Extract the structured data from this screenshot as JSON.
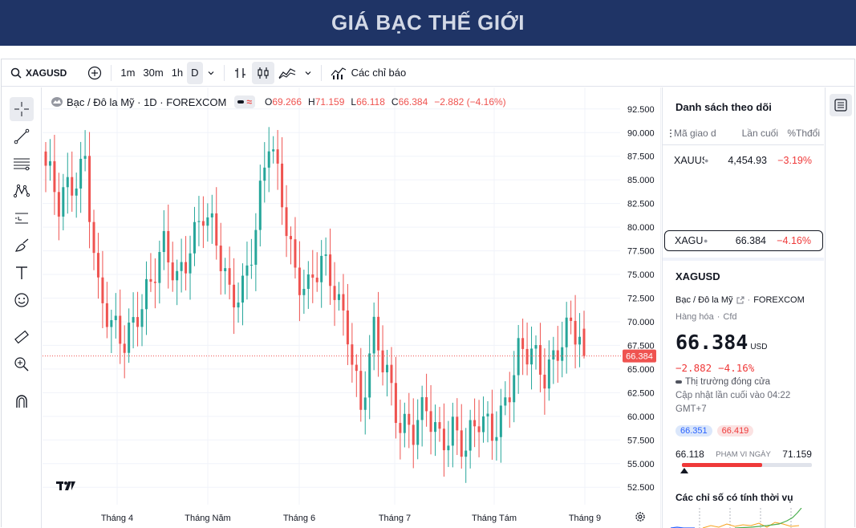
{
  "banner": {
    "title": "GIÁ BẠC THẾ GIỚI"
  },
  "toolbar": {
    "symbol": "XAGUSD",
    "intervals": [
      "1m",
      "30m",
      "1h",
      "D"
    ],
    "indicators_label": "Các chỉ báo"
  },
  "legend": {
    "title": "Bạc / Đô la Mỹ · 1D · FOREXCOM",
    "o_label": "O",
    "o": "69.266",
    "h_label": "H",
    "h": "71.159",
    "l_label": "L",
    "l": "66.118",
    "c_label": "C",
    "c": "66.384",
    "change": "−2.882 (−4.16%)"
  },
  "chart_data": {
    "type": "candlestick",
    "ylim": [
      51.5,
      93.5
    ],
    "y_ticks": [
      "92.500",
      "90.000",
      "87.500",
      "85.000",
      "82.500",
      "80.000",
      "77.500",
      "75.000",
      "72.500",
      "70.000",
      "67.500",
      "65.000",
      "62.500",
      "60.000",
      "57.500",
      "55.000",
      "52.500"
    ],
    "x_ticks": [
      "Tháng 4",
      "Tháng Năm",
      "Tháng 6",
      "Tháng 7",
      "Tháng Tám",
      "Tháng 9"
    ],
    "last_price": "66.384",
    "close_path": [
      [
        0,
        86.5
      ],
      [
        3,
        81.5
      ],
      [
        6,
        84.5
      ],
      [
        9,
        88
      ],
      [
        12,
        73
      ],
      [
        15,
        68.5
      ],
      [
        18,
        68
      ],
      [
        21,
        72
      ],
      [
        24,
        74
      ],
      [
        27,
        77
      ],
      [
        30,
        74.5
      ],
      [
        33,
        79
      ],
      [
        36,
        81.5
      ],
      [
        39,
        77.5
      ],
      [
        42,
        73
      ],
      [
        45,
        74.5
      ],
      [
        48,
        79.5
      ],
      [
        51,
        88.5
      ],
      [
        54,
        83.5
      ],
      [
        57,
        76
      ],
      [
        60,
        73
      ],
      [
        63,
        75.5
      ],
      [
        66,
        74
      ],
      [
        69,
        70
      ],
      [
        72,
        60
      ],
      [
        75,
        68
      ],
      [
        78,
        65
      ],
      [
        81,
        60
      ],
      [
        84,
        58
      ],
      [
        87,
        60
      ],
      [
        90,
        58
      ],
      [
        93,
        59.5
      ],
      [
        96,
        56
      ],
      [
        99,
        59
      ],
      [
        102,
        59
      ],
      [
        105,
        62
      ],
      [
        108,
        66
      ],
      [
        111,
        66
      ],
      [
        114,
        65
      ],
      [
        117,
        68
      ],
      [
        120,
        69
      ],
      [
        123,
        66.384
      ]
    ]
  },
  "watchlist": {
    "title": "Danh sách theo dõi",
    "headers": [
      "Mã giao d",
      "Lần cuối",
      "%Thđổi"
    ],
    "rows": [
      {
        "symbol": "XAUUSD",
        "last": "4,454.93",
        "change": "−3.19%"
      },
      {
        "symbol": "XAGUSD",
        "last": "66.384",
        "change": "−4.16%"
      }
    ]
  },
  "detail": {
    "symbol": "XAGUSD",
    "name": "Bạc / Đô la Mỹ",
    "exchange": "FOREXCOM",
    "category": "Hàng hóa",
    "type": "Cfd",
    "price": "66.384",
    "currency": "USD",
    "change": "−2.882",
    "change_pct": "−4.16%",
    "market_status": "Thị trường đóng cửa",
    "updated": "Cập nhật lần cuối vào 04:22",
    "tz": "GMT+7",
    "bid": "66.351",
    "ask": "66.419",
    "range_low": "66.118",
    "range_label": "PHẠM VI NGÀY",
    "range_high": "71.159",
    "seasonal_title": "Các chỉ số có tính thời vụ"
  },
  "colors": {
    "banner": "#1f3466",
    "up": "#26a69a",
    "down": "#ef5350"
  }
}
